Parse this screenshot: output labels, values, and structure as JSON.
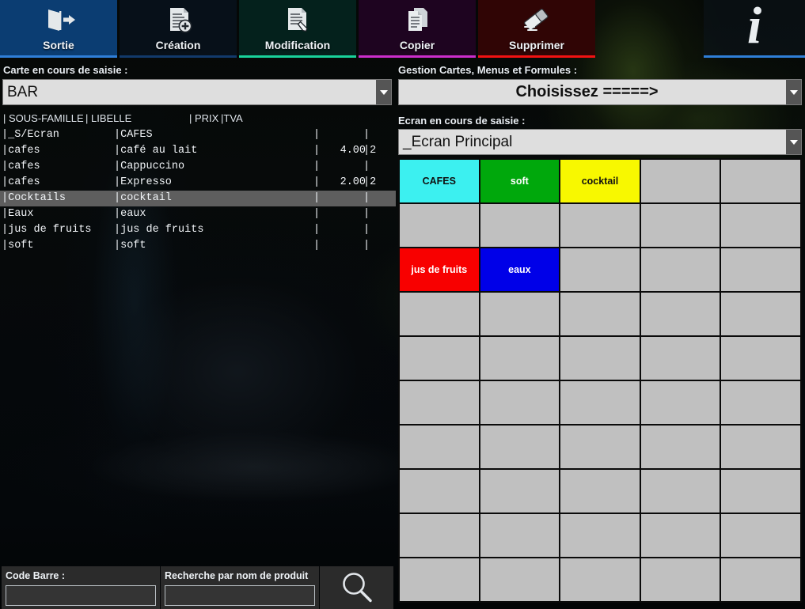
{
  "toolbar": {
    "buttons": [
      {
        "id": "sortie",
        "label": "Sortie",
        "icon": "exit-door-icon",
        "bg": "#0b3d72",
        "rule": "#2f7fd8"
      },
      {
        "id": "creation",
        "label": "Création",
        "icon": "document-add-icon",
        "bg": "#071019",
        "rule": "#123a6b"
      },
      {
        "id": "modification",
        "label": "Modification",
        "icon": "document-pencil-icon",
        "bg": "#04211c",
        "rule": "#19d39b"
      },
      {
        "id": "copier",
        "label": "Copier",
        "icon": "document-copy-icon",
        "bg": "#1e0420",
        "rule": "#cc2ecc"
      },
      {
        "id": "supprimer",
        "label": "Supprimer",
        "icon": "eraser-icon",
        "bg": "#300505",
        "rule": "#f21212"
      }
    ],
    "info": {
      "label": "i",
      "icon": "info-icon",
      "rule": "#2f7fd8"
    }
  },
  "left": {
    "carte_label": "Carte en cours de saisie :",
    "carte_value": "BAR",
    "columns": [
      "| SOUS-FAMILLE",
      "| LIBELLE",
      "| PRIX",
      "|TVA"
    ],
    "rows": [
      {
        "famille": "|_S/Ecran",
        "libelle": "|CAFES",
        "prix": "",
        "tva": "",
        "selected": false
      },
      {
        "famille": "|cafes",
        "libelle": "|café au lait",
        "prix": "4.00",
        "tva": "2",
        "selected": false
      },
      {
        "famille": "|cafes",
        "libelle": "|Cappuccino",
        "prix": "",
        "tva": "",
        "selected": false
      },
      {
        "famille": "|cafes",
        "libelle": "|Expresso",
        "prix": "2.00",
        "tva": "2",
        "selected": false
      },
      {
        "famille": "|Cocktails",
        "libelle": "|cocktail",
        "prix": "",
        "tva": "",
        "selected": true
      },
      {
        "famille": "|Eaux",
        "libelle": "|eaux",
        "prix": "",
        "tva": "",
        "selected": false
      },
      {
        "famille": "|jus de fruits",
        "libelle": "|jus de fruits",
        "prix": "",
        "tva": "",
        "selected": false
      },
      {
        "famille": "|soft",
        "libelle": "|soft",
        "prix": "",
        "tva": "",
        "selected": false
      }
    ],
    "search": {
      "barcode_label": "Code Barre :",
      "barcode_value": "",
      "barcode_placeholder": "",
      "name_label": "Recherche par nom de produit",
      "name_value": "",
      "name_placeholder": "",
      "search_icon": "magnifier-icon"
    }
  },
  "right": {
    "gestion_label": "Gestion Cartes, Menus et Formules  :",
    "gestion_value": "Choisissez  =====>",
    "ecran_label": "Ecran en cours de saisie :",
    "ecran_value": "_Ecran Principal",
    "keypad": {
      "columns": 5,
      "rows": 10,
      "empty_bg": "#c0c0c0",
      "keys": [
        {
          "index": 0,
          "label": "CAFES",
          "bg": "#3cf0f0",
          "fg": "#101010"
        },
        {
          "index": 1,
          "label": "soft",
          "bg": "#00a80c",
          "fg": "#ffffff"
        },
        {
          "index": 2,
          "label": "cocktail",
          "bg": "#f8f800",
          "fg": "#101010"
        },
        {
          "index": 3,
          "label": "",
          "bg": "#c0c0c0",
          "fg": "#101010"
        },
        {
          "index": 4,
          "label": "",
          "bg": "#c0c0c0",
          "fg": "#101010"
        },
        {
          "index": 5,
          "label": "",
          "bg": "#c0c0c0",
          "fg": "#101010"
        },
        {
          "index": 6,
          "label": "",
          "bg": "#c0c0c0",
          "fg": "#101010"
        },
        {
          "index": 7,
          "label": "",
          "bg": "#c0c0c0",
          "fg": "#101010"
        },
        {
          "index": 8,
          "label": "",
          "bg": "#c0c0c0",
          "fg": "#101010"
        },
        {
          "index": 9,
          "label": "",
          "bg": "#c0c0c0",
          "fg": "#101010"
        },
        {
          "index": 10,
          "label": "jus de fruits",
          "bg": "#f80000",
          "fg": "#ffffff"
        },
        {
          "index": 11,
          "label": "eaux",
          "bg": "#0000e8",
          "fg": "#ffffff"
        },
        {
          "index": 12,
          "label": "",
          "bg": "#c0c0c0",
          "fg": "#101010"
        },
        {
          "index": 13,
          "label": "",
          "bg": "#c0c0c0",
          "fg": "#101010"
        },
        {
          "index": 14,
          "label": "",
          "bg": "#c0c0c0",
          "fg": "#101010"
        }
      ]
    }
  }
}
